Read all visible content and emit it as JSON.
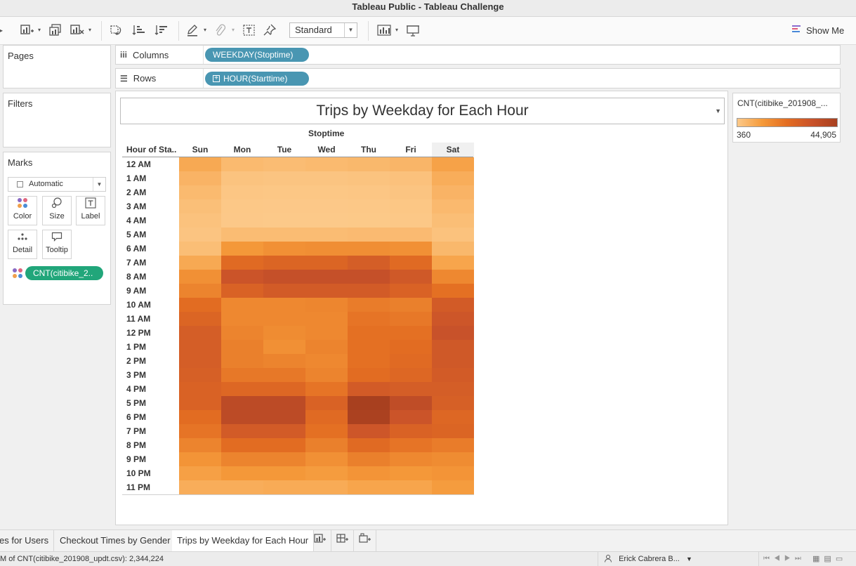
{
  "window": {
    "title": "Tableau Public - Tableau Challenge"
  },
  "toolbar": {
    "icons": [
      "new-worksheet-icon",
      "duplicate-sheet-icon",
      "clear-sheet-icon",
      "swap-rows-columns-icon",
      "sort-ascending-icon",
      "sort-descending-icon",
      "highlight-icon",
      "group-icon",
      "show-labels-icon",
      "pin-icon",
      "show-cards-icon",
      "presentation-icon"
    ],
    "fit_select": "Standard",
    "show_me": "Show Me"
  },
  "pages": {
    "title": "Pages"
  },
  "filters": {
    "title": "Filters"
  },
  "marks": {
    "title": "Marks",
    "mark_type": "Automatic",
    "buttons": {
      "color": "Color",
      "size": "Size",
      "label": "Label",
      "detail": "Detail",
      "tooltip": "Tooltip"
    },
    "pill": "CNT(citibike_2.."
  },
  "shelves": {
    "columns_label": "Columns",
    "columns_pill": "WEEKDAY(Stoptime)",
    "rows_label": "Rows",
    "rows_pill": "HOUR(Starttime)"
  },
  "sheet": {
    "title": "Trips by Weekday for Each Hour",
    "column_field": "Stoptime",
    "row_header": "Hour of Sta..",
    "days": [
      "Sun",
      "Mon",
      "Tue",
      "Wed",
      "Thu",
      "Fri",
      "Sat"
    ],
    "hours": [
      "12 AM",
      "1 AM",
      "2 AM",
      "3 AM",
      "4 AM",
      "5 AM",
      "6 AM",
      "7 AM",
      "8 AM",
      "9 AM",
      "10 AM",
      "11 AM",
      "12 PM",
      "1 PM",
      "2 PM",
      "3 PM",
      "4 PM",
      "5 PM",
      "6 PM",
      "7 PM",
      "8 PM",
      "9 PM",
      "10 PM",
      "11 PM"
    ]
  },
  "chart_data": {
    "type": "heatmap",
    "title": "Trips by Weekday for Each Hour",
    "x": [
      "Sun",
      "Mon",
      "Tue",
      "Wed",
      "Thu",
      "Fri",
      "Sat"
    ],
    "y": [
      "12 AM",
      "1 AM",
      "2 AM",
      "3 AM",
      "4 AM",
      "5 AM",
      "6 AM",
      "7 AM",
      "8 AM",
      "9 AM",
      "10 AM",
      "11 AM",
      "12 PM",
      "1 PM",
      "2 PM",
      "3 PM",
      "4 PM",
      "5 PM",
      "6 PM",
      "7 PM",
      "8 PM",
      "9 PM",
      "10 PM",
      "11 PM"
    ],
    "xlabel": "Stoptime",
    "ylabel": "Hour of Sta..",
    "color_measure": "CNT(citibike_201908_...",
    "color_range": [
      360,
      44905
    ],
    "color_range_labels": [
      "360",
      "44,905"
    ],
    "colors": [
      "#fcc989",
      "#f59a3a",
      "#e36d22",
      "#c9522a",
      "#a8401f"
    ],
    "values": [
      [
        8000,
        4000,
        3500,
        4000,
        4500,
        5000,
        9500
      ],
      [
        5500,
        1800,
        1500,
        1500,
        1800,
        2200,
        7000
      ],
      [
        4000,
        1000,
        900,
        900,
        1000,
        1500,
        5500
      ],
      [
        2800,
        600,
        500,
        500,
        600,
        900,
        4200
      ],
      [
        2000,
        500,
        400,
        400,
        450,
        600,
        3000
      ],
      [
        1500,
        3500,
        3500,
        3500,
        3800,
        3800,
        2000
      ],
      [
        3000,
        12000,
        14000,
        14500,
        14500,
        14000,
        4500
      ],
      [
        8000,
        24000,
        26000,
        26000,
        29000,
        24000,
        9000
      ],
      [
        14000,
        33000,
        35000,
        35000,
        35000,
        31000,
        16000
      ],
      [
        17000,
        27000,
        30000,
        30000,
        30000,
        27000,
        22000
      ],
      [
        23000,
        16000,
        16000,
        16500,
        19000,
        18000,
        30000
      ],
      [
        26000,
        16000,
        16000,
        16000,
        21000,
        20000,
        32000
      ],
      [
        29000,
        17000,
        15000,
        16000,
        22000,
        22000,
        34000
      ],
      [
        29000,
        18000,
        14000,
        17000,
        22000,
        23000,
        31000
      ],
      [
        29000,
        18000,
        17000,
        16000,
        22000,
        24000,
        31000
      ],
      [
        28000,
        20000,
        20000,
        17000,
        23000,
        25000,
        30000
      ],
      [
        27000,
        25000,
        25000,
        21000,
        30000,
        29000,
        29000
      ],
      [
        27000,
        38000,
        38000,
        27000,
        44905,
        37000,
        28000
      ],
      [
        23000,
        38000,
        38000,
        24000,
        44000,
        33000,
        25000
      ],
      [
        21000,
        30000,
        30000,
        22000,
        32000,
        27000,
        26000
      ],
      [
        17000,
        23000,
        23000,
        18000,
        24000,
        21000,
        19000
      ],
      [
        13000,
        17000,
        17000,
        14000,
        18000,
        16000,
        15000
      ],
      [
        10000,
        12000,
        12000,
        11000,
        13000,
        12000,
        13000
      ],
      [
        7000,
        7000,
        7500,
        7500,
        9000,
        9000,
        11000
      ]
    ]
  },
  "legend": {
    "title": "CNT(citibike_201908_...",
    "min": "360",
    "max": "44,905"
  },
  "tabs": {
    "items": [
      "es for Users",
      "Checkout Times by Gender",
      "Trips by Weekday for Each Hour"
    ],
    "active": 2
  },
  "status": {
    "summary": "M of CNT(citibike_201908_updt.csv): 2,344,224",
    "user": "Erick Cabrera B..."
  }
}
